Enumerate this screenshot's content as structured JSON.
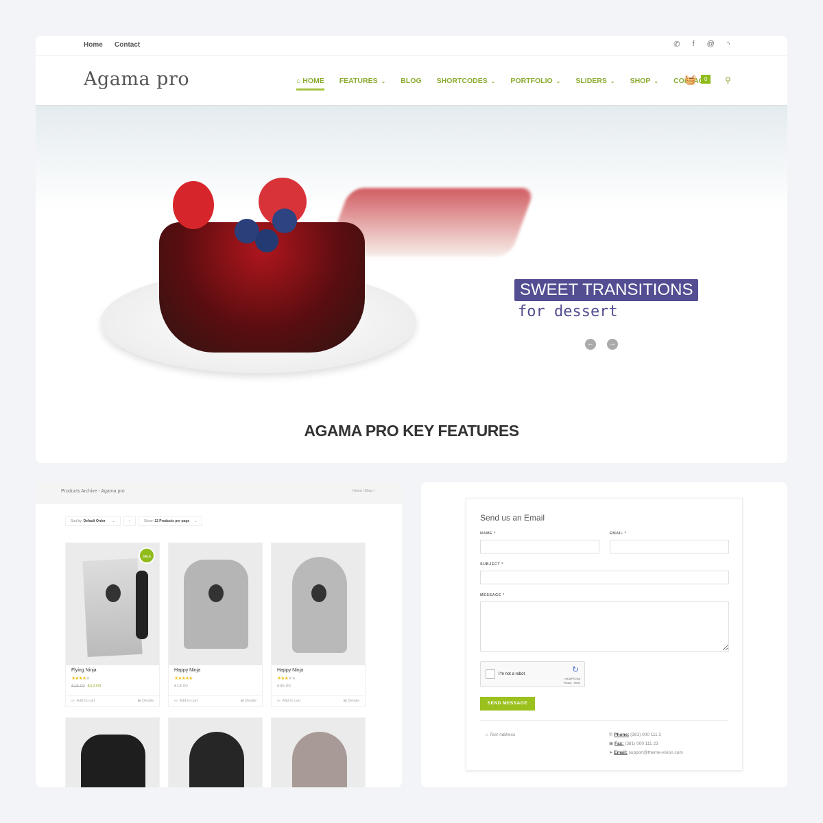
{
  "topbar": {
    "links": [
      "Home",
      "Contact"
    ],
    "icons": [
      "phone-icon",
      "facebook-icon",
      "at-icon",
      "rss-icon"
    ]
  },
  "header": {
    "logo": "Agama pro",
    "nav": [
      {
        "label": "HOME",
        "active": true
      },
      {
        "label": "FEATURES",
        "dropdown": true
      },
      {
        "label": "BLOG"
      },
      {
        "label": "SHORTCODES",
        "dropdown": true
      },
      {
        "label": "PORTFOLIO",
        "dropdown": true
      },
      {
        "label": "SLIDERS",
        "dropdown": true
      },
      {
        "label": "SHOP",
        "dropdown": true
      },
      {
        "label": "CONTACT"
      }
    ],
    "cart_count": "0"
  },
  "hero": {
    "title": "SWEET TRANSITIONS",
    "subtitle": "for dessert"
  },
  "features_heading": "AGAMA PRO KEY FEATURES",
  "shop": {
    "page_title": "Products Archive - Agama pro",
    "breadcrumb": "Home / Shop /",
    "sort_prefix": "Sort by:",
    "sort_value": "Default Order",
    "show_prefix": "Show:",
    "show_value": "12 Products per page",
    "sale_badge": "SALE",
    "products": [
      {
        "name": "Flying Ninja",
        "rating": 4,
        "old_price": "£15.00",
        "price": "£12.00"
      },
      {
        "name": "Happy Ninja",
        "rating": 5,
        "price": "£18.00"
      },
      {
        "name": "Happy Ninja",
        "rating": 3,
        "price": "£35.00"
      }
    ],
    "add_to_cart": "Add to cart",
    "details": "Details"
  },
  "contact": {
    "title": "Send us an Email",
    "name_label": "NAME *",
    "email_label": "EMAIL *",
    "subject_label": "SUBJECT *",
    "message_label": "MESSAGE *",
    "captcha_text": "I'm not a robot",
    "captcha_brand": "reCAPTCHA",
    "captcha_links": "Privacy - Terms",
    "send": "SEND MESSAGE",
    "address": "Test Address",
    "phone_label": "Phone:",
    "phone": "(381) 000 111 2",
    "fax_label": "Fax:",
    "fax": "(381) 000 111 23",
    "email_label2": "Email:",
    "email": "support@theme-vision.com"
  },
  "colors": {
    "accent": "#8fbb1b",
    "hero_box": "#534e92"
  }
}
